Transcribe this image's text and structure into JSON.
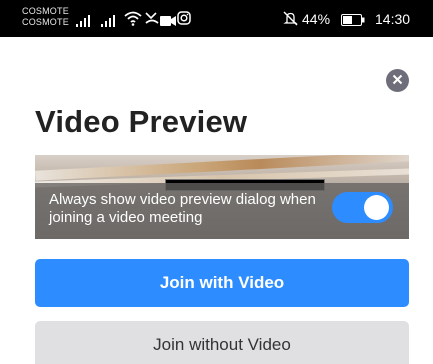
{
  "status_bar": {
    "carrier_1": "COSMOTE",
    "carrier_2": "COSMOTE",
    "battery_percent": "44%",
    "time": "14:30",
    "icons": [
      "signal-icon",
      "signal-icon",
      "wifi-icon",
      "missed-call-icon",
      "video-camera-icon",
      "instagram-icon",
      "mute-icon",
      "battery-icon"
    ]
  },
  "dialog": {
    "title": "Video Preview",
    "close_icon": "close-icon",
    "preview_option_text": "Always show video preview dialog when joining a video meeting",
    "preview_option_enabled": true,
    "join_with_video_label": "Join with Video",
    "join_without_video_label": "Join without Video"
  },
  "colors": {
    "accent": "#2d8cff",
    "secondary_button": "#e0e0e3",
    "close_button": "#6e6e7a"
  }
}
